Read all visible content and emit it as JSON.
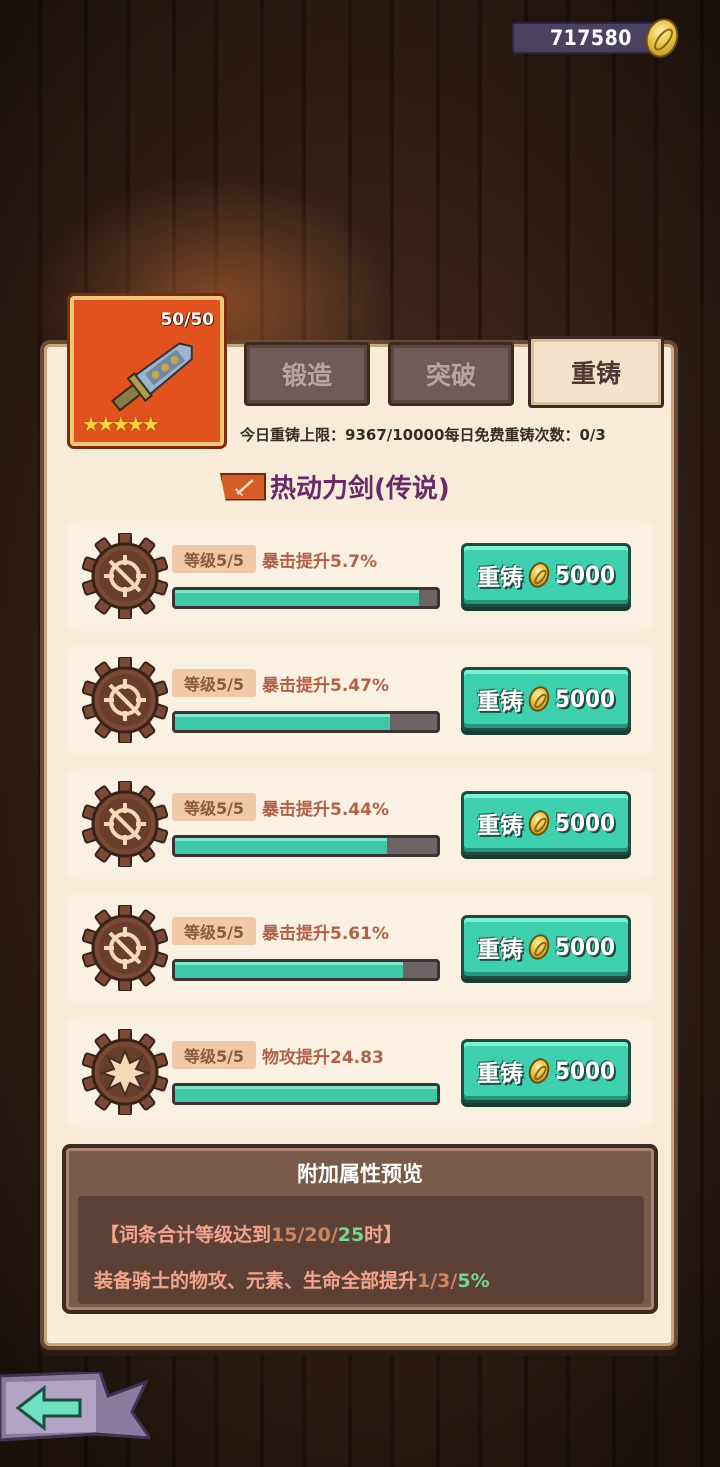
{
  "currency": {
    "amount": "717580",
    "icon": "gold-coin-icon"
  },
  "weapon": {
    "level": "50/50",
    "stars": 5,
    "star_glyphs": "★★★★★"
  },
  "tabs": [
    {
      "label": "锻造",
      "active": false
    },
    {
      "label": "突破",
      "active": false
    },
    {
      "label": "重铸",
      "active": true
    }
  ],
  "limits": {
    "daily_label": "今日重铸上限：",
    "daily_value": "9367/10000",
    "free_label": "每日免费重铸次数：",
    "free_value": "0/3"
  },
  "item_title": "热动力剑(传说)",
  "rows": [
    {
      "badge": "等级5/5",
      "stat": "暴击提升5.7%",
      "progress": 0.93,
      "icon": "crosshair-gear-icon",
      "button_label": "重铸",
      "cost": "5000"
    },
    {
      "badge": "等级5/5",
      "stat": "暴击提升5.47%",
      "progress": 0.82,
      "icon": "crosshair-gear-icon",
      "button_label": "重铸",
      "cost": "5000"
    },
    {
      "badge": "等级5/5",
      "stat": "暴击提升5.44%",
      "progress": 0.81,
      "icon": "crosshair-gear-icon",
      "button_label": "重铸",
      "cost": "5000"
    },
    {
      "badge": "等级5/5",
      "stat": "暴击提升5.61%",
      "progress": 0.87,
      "icon": "crosshair-gear-icon",
      "button_label": "重铸",
      "cost": "5000"
    },
    {
      "badge": "等级5/5",
      "stat": "物攻提升24.83",
      "progress": 1.0,
      "icon": "explosion-gear-icon",
      "button_label": "重铸",
      "cost": "5000"
    }
  ],
  "preview": {
    "title": "附加属性预览",
    "line1_prefix": "【词条合计等级达到",
    "line1_a": "15/20/",
    "line1_b": "25",
    "line1_suffix": "时】",
    "line2_prefix": "装备骑士的物攻、元素、生命全部提升",
    "line2_a": "1/3/",
    "line2_b": "5%"
  },
  "colors": {
    "accent_green": "#3ed0ad",
    "highlight": "#74d88a",
    "title_purple": "#6a2a6a"
  }
}
